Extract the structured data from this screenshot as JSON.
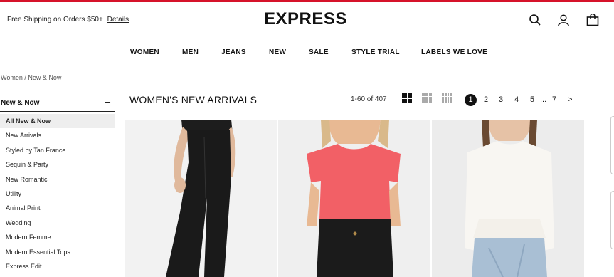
{
  "header": {
    "shipping_text": "Free Shipping on Orders $50+",
    "shipping_link": "Details",
    "logo": "EXPRESS",
    "icons": [
      "search-icon",
      "account-icon",
      "bag-icon"
    ]
  },
  "nav": {
    "items": [
      "WOMEN",
      "MEN",
      "JEANS",
      "NEW",
      "SALE",
      "STYLE TRIAL",
      "LABELS WE LOVE"
    ]
  },
  "breadcrumb": "Women / New & Now",
  "sidebar": {
    "heading": "New & Now",
    "collapse_symbol": "–",
    "items": [
      "All New & Now",
      "New Arrivals",
      "Styled by Tan France",
      "Sequin & Party",
      "New Romantic",
      "Utility",
      "Animal Print",
      "Wedding",
      "Modern Femme",
      "Modern Essential Tops",
      "Express Edit"
    ]
  },
  "main": {
    "title": "WOMEN'S NEW ARRIVALS",
    "count": "1-60 of 407",
    "pagination": {
      "current": "1",
      "pages": [
        "2",
        "3",
        "4",
        "5"
      ],
      "ellipsis": "...",
      "last": "7",
      "next": ">"
    }
  },
  "colors": {
    "accent": "#d6132a",
    "text": "#111111"
  }
}
